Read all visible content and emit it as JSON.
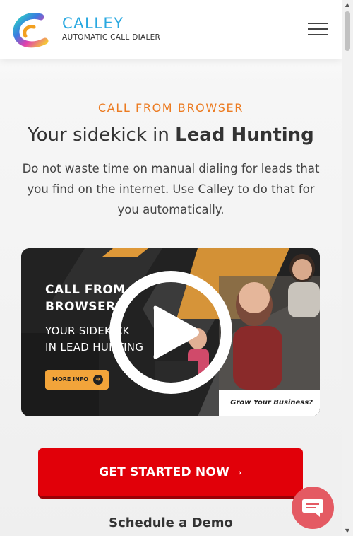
{
  "header": {
    "brand_name": "CALLEY",
    "brand_tagline": "AUTOMATIC CALL DIALER",
    "menu_icon": "hamburger-menu-icon"
  },
  "hero": {
    "eyebrow": "CALL FROM BROWSER",
    "headline_prefix": "Your sidekick in ",
    "headline_bold": "Lead Hunting",
    "subtext": "Do not waste time on manual dialing for leads that you find on the internet. Use Calley to do that for you automatically."
  },
  "video": {
    "title_line1": "CALL FROM",
    "title_line2": "BROWSER",
    "subtitle_line1": "YOUR SIDEKICK",
    "subtitle_line2": "IN LEAD HUNTING",
    "more_info": "MORE INFO",
    "tagline": "Grow Your Business?",
    "play_icon": "play-icon"
  },
  "cta": {
    "get_started": "GET STARTED NOW",
    "chevron": "›",
    "schedule_demo": "Schedule a Demo"
  },
  "chat": {
    "icon": "chat-bubble-icon"
  },
  "colors": {
    "brand_blue": "#29a8e0",
    "accent_orange": "#ec7b21",
    "cta_red": "#e10009",
    "chat_pink": "#e45a63"
  }
}
